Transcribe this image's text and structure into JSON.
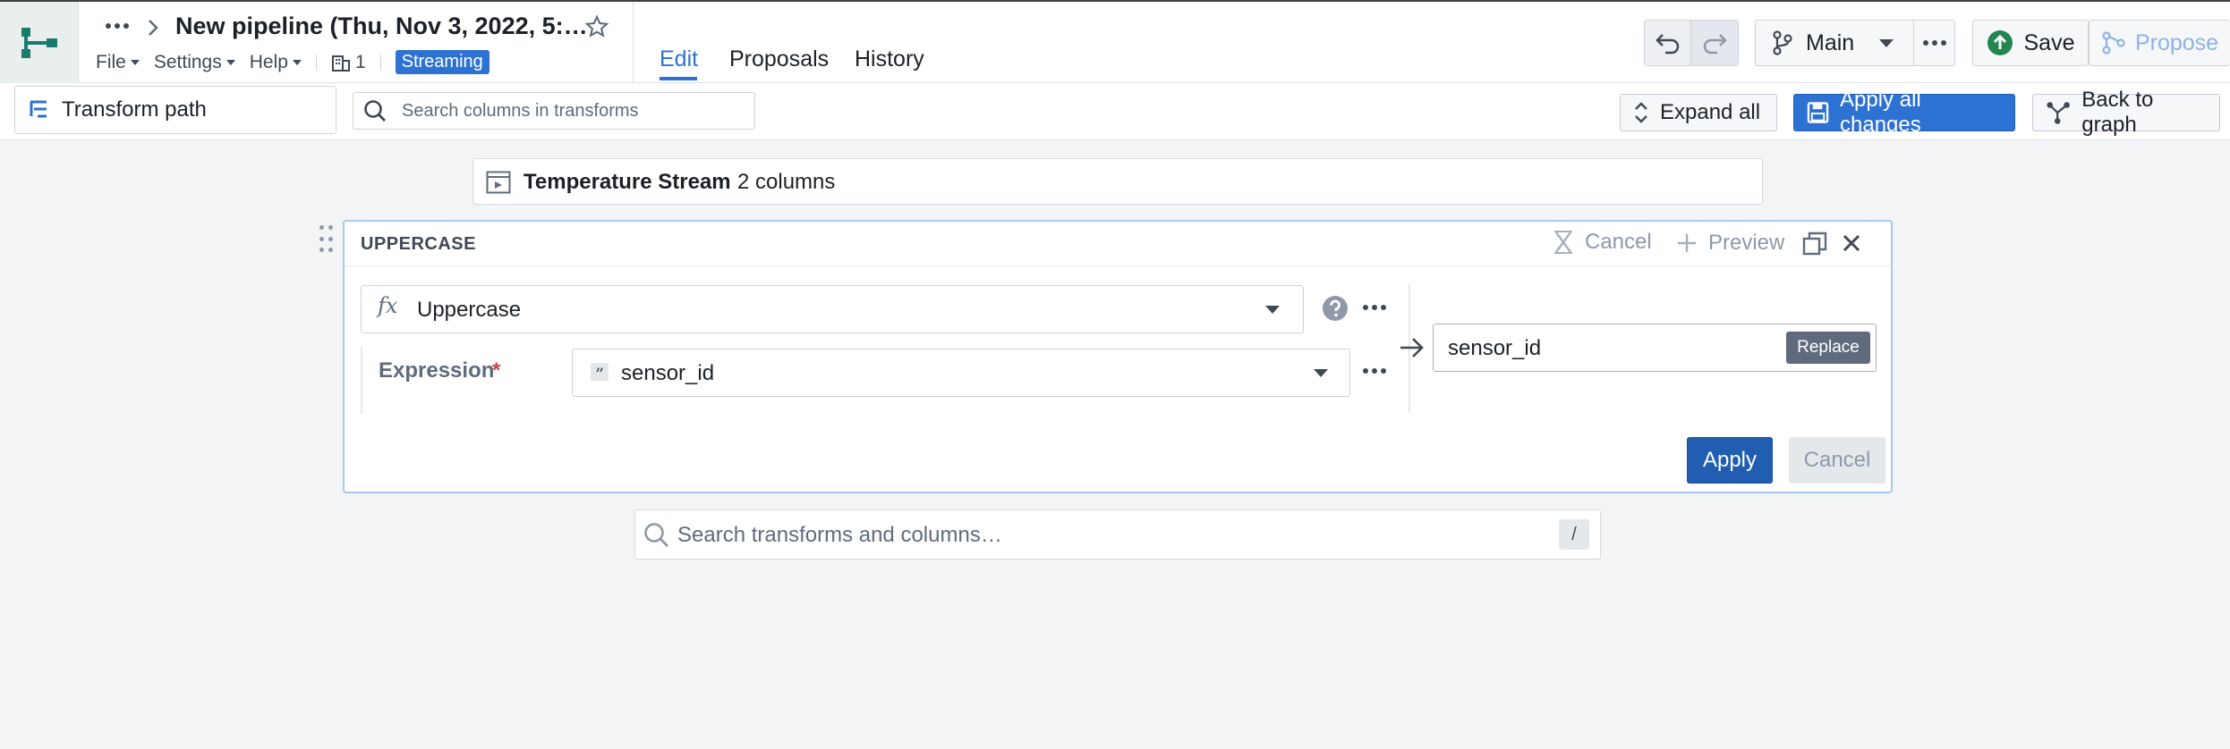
{
  "header": {
    "title": "New pipeline (Thu, Nov 3, 2022, 5:…",
    "menus": [
      "File",
      "Settings",
      "Help"
    ],
    "workspace_count": "1",
    "streaming_badge": "Streaming",
    "tabs": [
      "Edit",
      "Proposals",
      "History"
    ],
    "active_tab": "Edit",
    "branch": "Main",
    "save_label": "Save",
    "propose_label": "Propose"
  },
  "toolbar": {
    "transform_path_label": "Transform path",
    "search_placeholder": "Search columns in transforms",
    "expand_all_label": "Expand all",
    "apply_all_label": "Apply all changes",
    "back_to_graph_label": "Back to graph"
  },
  "source": {
    "name": "Temperature Stream",
    "columns": "2 columns"
  },
  "transform": {
    "heading": "UPPERCASE",
    "cancel_label": "Cancel",
    "preview_label": "Preview",
    "function_name": "Uppercase",
    "expression_label": "Expression",
    "required_mark": "*",
    "expression_value": "sensor_id",
    "output_value": "sensor_id",
    "replace_label": "Replace",
    "apply_label": "Apply",
    "cancel_button_label": "Cancel"
  },
  "bottom_search": {
    "placeholder": "Search transforms and columns…",
    "shortcut": "/"
  },
  "colors": {
    "accent": "#2d72d2",
    "streaming": "#2d72d2",
    "save_icon": "#238551",
    "card_border": "#a6c8f0"
  },
  "icons": [
    "pipeline-logo-icon",
    "more-icon",
    "chevron-right-icon",
    "star-icon",
    "building-icon",
    "undo-icon",
    "redo-icon",
    "branch-icon",
    "save-icon",
    "propose-icon",
    "transform-path-icon",
    "search-icon",
    "expand-icon",
    "floppy-icon",
    "back-to-graph-icon",
    "table-icon",
    "drag-handle-icon",
    "function-icon",
    "help-icon",
    "quote-icon",
    "arrow-right-icon",
    "close-icon",
    "copy-icon",
    "plus-icon",
    "cancel-x-icon"
  ]
}
